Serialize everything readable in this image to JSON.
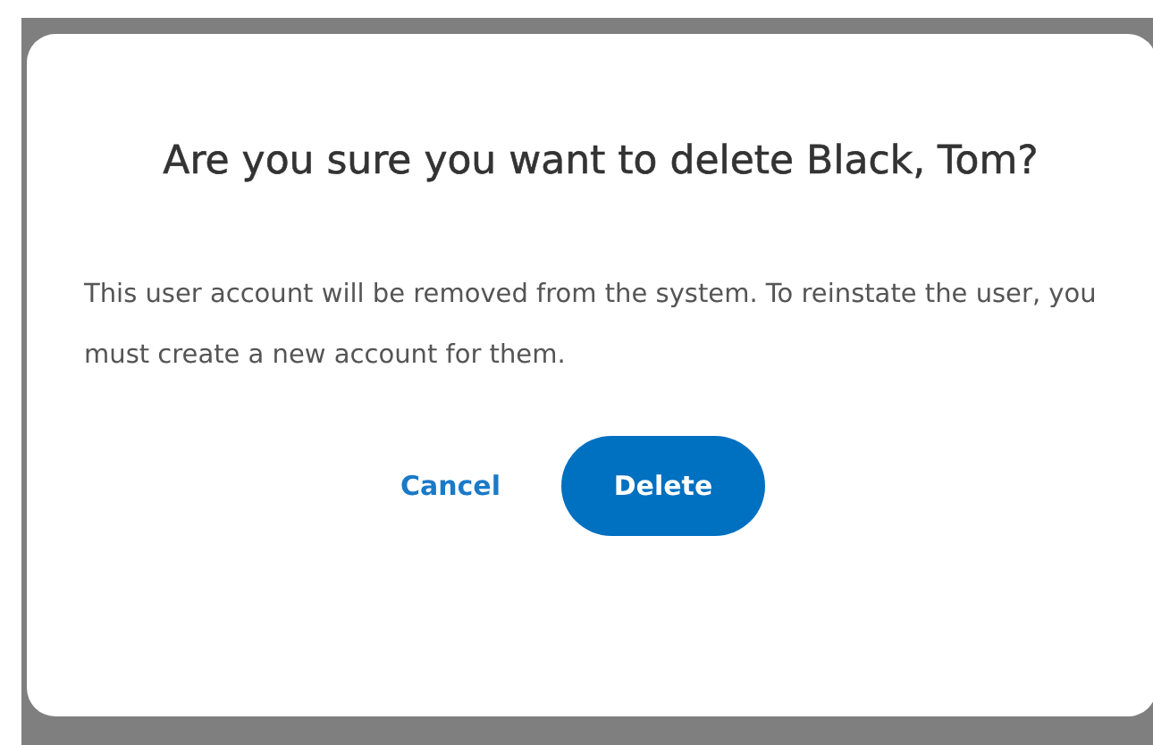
{
  "dialog": {
    "title": "Are you sure you want to delete Black, Tom?",
    "message": "This user account will be removed from the system. To reinstate the user, you must create a new account for them.",
    "buttons": [
      {
        "label": "Cancel",
        "kind": "link"
      },
      {
        "label": "Delete",
        "kind": "primary"
      }
    ]
  }
}
